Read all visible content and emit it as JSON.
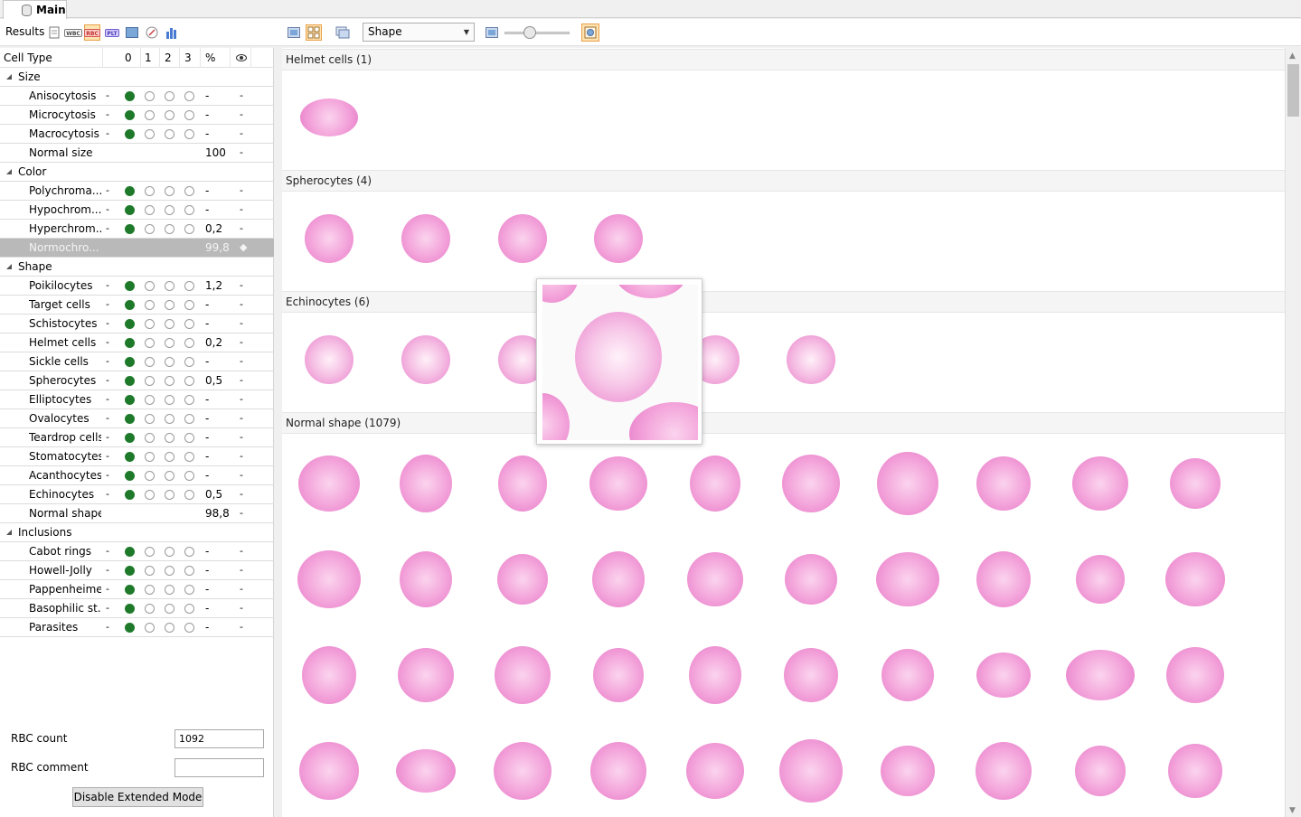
{
  "tab": {
    "label": "Main"
  },
  "toolbar": {
    "results_label": "Results",
    "icons": [
      "report-icon",
      "wbc-icon",
      "rbc-icon",
      "plt-icon",
      "overview-icon",
      "compass-icon",
      "histogram-icon"
    ],
    "badges": {
      "wbc": "WBC",
      "rbc": "RBC",
      "plt": "PLT"
    },
    "sort_select": "Shape",
    "view_icons": [
      "single-view-icon",
      "grid-view-icon",
      "stack-view-icon",
      "fit-icon",
      "zoom-toggle-icon"
    ]
  },
  "table": {
    "header": {
      "name": "Cell Type",
      "c0": "0",
      "c1": "1",
      "c2": "2",
      "c3": "3",
      "pct": "%"
    },
    "groups": [
      {
        "label": "Size",
        "rows": [
          {
            "name": "Anisocytosis",
            "dash": "-",
            "pct": "-",
            "eye": "-",
            "grade": 0
          },
          {
            "name": "Microcytosis",
            "dash": "-",
            "pct": "-",
            "eye": "-",
            "grade": 0
          },
          {
            "name": "Macrocytosis",
            "dash": "-",
            "pct": "-",
            "eye": "-",
            "grade": 0
          },
          {
            "name": "Normal size",
            "dash": "",
            "pct": "100",
            "eye": "-",
            "grade": -1
          }
        ]
      },
      {
        "label": "Color",
        "rows": [
          {
            "name": "Polychroma...",
            "dash": "-",
            "pct": "-",
            "eye": "-",
            "grade": 0
          },
          {
            "name": "Hypochrom...",
            "dash": "-",
            "pct": "-",
            "eye": "-",
            "grade": 0
          },
          {
            "name": "Hyperchrom...",
            "dash": "-",
            "pct": "0,2",
            "eye": "-",
            "grade": 0
          },
          {
            "name": "Normochro...",
            "dash": "",
            "pct": "99,8",
            "eye": "◆",
            "grade": -1,
            "selected": true
          }
        ]
      },
      {
        "label": "Shape",
        "rows": [
          {
            "name": "Poikilocytes",
            "dash": "-",
            "pct": "1,2",
            "eye": "-",
            "grade": 0
          },
          {
            "name": "Target cells",
            "dash": "-",
            "pct": "-",
            "eye": "-",
            "grade": 0
          },
          {
            "name": "Schistocytes",
            "dash": "-",
            "pct": "-",
            "eye": "-",
            "grade": 0
          },
          {
            "name": "Helmet cells",
            "dash": "-",
            "pct": "0,2",
            "eye": "-",
            "grade": 0
          },
          {
            "name": "Sickle cells",
            "dash": "-",
            "pct": "-",
            "eye": "-",
            "grade": 0
          },
          {
            "name": "Spherocytes",
            "dash": "-",
            "pct": "0,5",
            "eye": "-",
            "grade": 0
          },
          {
            "name": "Elliptocytes",
            "dash": "-",
            "pct": "-",
            "eye": "-",
            "grade": 0
          },
          {
            "name": "Ovalocytes",
            "dash": "-",
            "pct": "-",
            "eye": "-",
            "grade": 0
          },
          {
            "name": "Teardrop cells",
            "dash": "-",
            "pct": "-",
            "eye": "-",
            "grade": 0
          },
          {
            "name": "Stomatocytes",
            "dash": "-",
            "pct": "-",
            "eye": "-",
            "grade": 0
          },
          {
            "name": "Acanthocytes",
            "dash": "-",
            "pct": "-",
            "eye": "-",
            "grade": 0
          },
          {
            "name": "Echinocytes",
            "dash": "-",
            "pct": "0,5",
            "eye": "-",
            "grade": 0
          },
          {
            "name": "Normal shape",
            "dash": "",
            "pct": "98,8",
            "eye": "-",
            "grade": -1
          }
        ]
      },
      {
        "label": "Inclusions",
        "rows": [
          {
            "name": "Cabot rings",
            "dash": "-",
            "pct": "-",
            "eye": "-",
            "grade": 0
          },
          {
            "name": "Howell-Jolly",
            "dash": "-",
            "pct": "-",
            "eye": "-",
            "grade": 0
          },
          {
            "name": "Pappenheimer",
            "dash": "-",
            "pct": "-",
            "eye": "-",
            "grade": 0
          },
          {
            "name": "Basophilic st...",
            "dash": "-",
            "pct": "-",
            "eye": "-",
            "grade": 0
          },
          {
            "name": "Parasites",
            "dash": "-",
            "pct": "-",
            "eye": "-",
            "grade": 0
          }
        ]
      }
    ]
  },
  "footer": {
    "rbc_count_label": "RBC count",
    "rbc_count_value": "1092",
    "rbc_comment_label": "RBC comment",
    "rbc_comment_value": "",
    "extended_button": "Disable Extended Mode"
  },
  "gallery": {
    "sections": [
      {
        "title": "Helmet cells (1)",
        "count": 1
      },
      {
        "title": "Spherocytes (4)",
        "count": 4
      },
      {
        "title": "Echinocytes (6)",
        "count": 6
      },
      {
        "title": "Normal shape (1079)",
        "count": 40
      }
    ]
  },
  "colors": {
    "accent": "#1e7a2a",
    "selected_row": "#b9b9b9",
    "cell_pink": "#f3a3da",
    "toolbar_select": "#ffe3b0"
  }
}
